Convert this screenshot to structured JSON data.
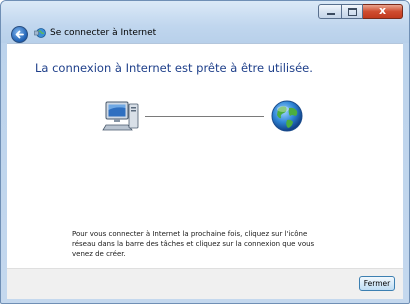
{
  "window": {
    "title": "Se connecter à Internet",
    "controls": {
      "minimize_icon": "minimize-icon",
      "maximize_icon": "maximize-icon",
      "close_glyph": "x"
    }
  },
  "main": {
    "heading": "La connexion à Internet est prête à être utilisée.",
    "instructions": "Pour vous connecter à Internet la prochaine fois, cliquez sur l'icône réseau dans la barre des tâches et cliquez sur la connexion que vous venez de créer.",
    "diagram": {
      "source_icon": "computer-icon",
      "target_icon": "globe-icon"
    }
  },
  "footer": {
    "close_label": "Fermer"
  },
  "colors": {
    "heading": "#1e3f8a",
    "titlebar": "#c0d6ee",
    "close_control": "#cf4d30"
  }
}
